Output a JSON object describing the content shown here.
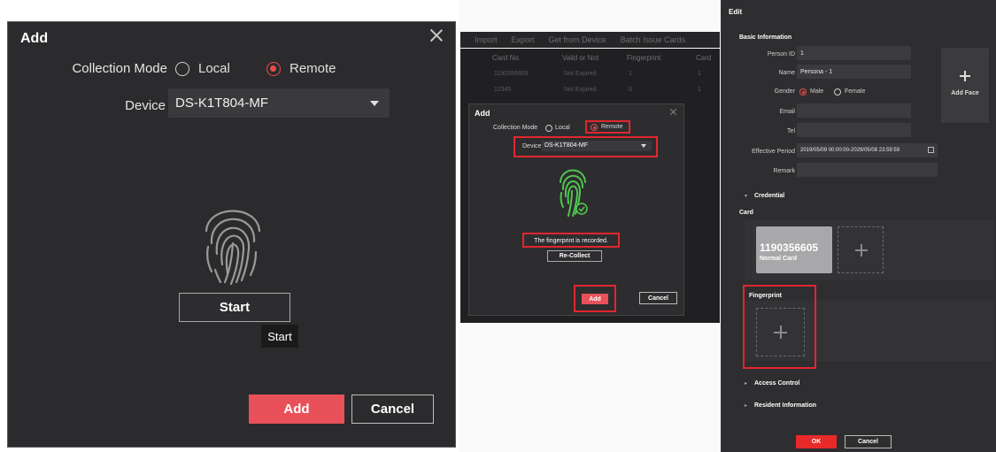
{
  "left_dialog": {
    "title": "Add",
    "collection_mode_label": "Collection Mode",
    "option_local": "Local",
    "option_remote": "Remote",
    "device_label": "Device",
    "device_value": "DS-K1T804-MF",
    "start_button": "Start",
    "tooltip": "Start",
    "add_button": "Add",
    "cancel_button": "Cancel"
  },
  "toolbar": {
    "import": "Import",
    "export": "Export",
    "get_from_device": "Get from Device",
    "batch_issue": "Batch Issue Cards"
  },
  "table": {
    "headers": [
      "Card No.",
      "Valid or Not",
      "Fingerprint",
      "Card"
    ],
    "rows": [
      [
        "1190356605",
        "Not Expired",
        "1",
        "1"
      ],
      [
        "12345",
        "Not Expired",
        "0",
        "1"
      ]
    ]
  },
  "middle_dialog": {
    "title": "Add",
    "collection_mode_label": "Collection Mode",
    "option_local": "Local",
    "option_remote": "Remote",
    "device_label": "Device",
    "device_value": "DS-K1T804-MF",
    "message": "The fingerprint is recorded.",
    "recollect_button": "Re-Collect",
    "add_button": "Add",
    "cancel_button": "Cancel"
  },
  "edit_panel": {
    "title": "Edit",
    "basic_info": "Basic Information",
    "person_id_label": "Person ID",
    "person_id_value": "1",
    "name_label": "Name",
    "name_value": "Persona - 1",
    "gender_label": "Gender",
    "gender_male": "Male",
    "gender_female": "Female",
    "add_face": "Add Face",
    "email_label": "Email",
    "tel_label": "Tel",
    "effective_period_label": "Effective Period",
    "effective_period_value": "2019/05/09 00:00:00-2029/05/08 23:59:59",
    "remark_label": "Remark",
    "credential": "Credential",
    "card": "Card",
    "card_number": "1190356605",
    "card_type": "Normal Card",
    "fingerprint": "Fingerprint",
    "access_control": "Access Control",
    "resident_information": "Resident Information",
    "ok_button": "OK",
    "cancel_button": "Cancel"
  },
  "colors": {
    "accent_red": "#e8505a",
    "highlight_red": "#e2262d",
    "dialog_bg": "#2b2b2d",
    "fingerprint_green": "#4fc54f"
  },
  "icons": [
    "close-icon",
    "fingerprint-icon",
    "chevron-down-icon",
    "plus-icon",
    "calendar-icon",
    "check-icon"
  ]
}
